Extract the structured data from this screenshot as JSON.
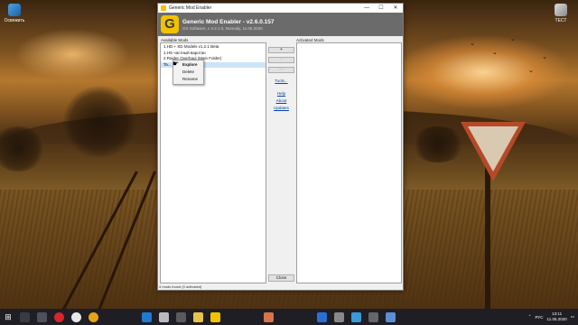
{
  "desktop": {
    "icons": [
      {
        "label": "Освежить"
      },
      {
        "label": "ТЕСТ"
      }
    ]
  },
  "window": {
    "title": "Generic Mod Enabler",
    "controls": {
      "minimize": "—",
      "maximize": "☐",
      "close": "✕"
    }
  },
  "header": {
    "logo_letter": "G",
    "app_name": "Generic Mod Enabler - v2.6.0.157",
    "subtitle": "GS Software, v 4.2.1.0, Nonnaly, 11.05.2020"
  },
  "available": {
    "label": "Available Mods",
    "items": [
      "1.HD + SD Models v1.2.1 Beta",
      "1.HS частный варотан",
      "2.Raider Overhaul (Main Folder)",
      "Ta..."
    ]
  },
  "activated": {
    "label": "Activated Mods",
    "items": []
  },
  "buttons": {
    "add": "+",
    "remove": "-",
    "remove_all": "---",
    "tools": "Tools...",
    "help": "Help",
    "about": "About",
    "updates": "Updates",
    "close": "Close"
  },
  "status": "4 mods found (0 activated)",
  "context_menu": {
    "items": [
      "Explore",
      "Delete",
      "Rename"
    ]
  },
  "taskbar": {
    "tray_lang": "РУС",
    "time": "13:11",
    "date": "11.05.2020"
  },
  "colors": {
    "header_bg": "#6b6b6b",
    "logo": "#f2c200",
    "taskbar": "#1e1e24",
    "selection": "#cce4f7"
  }
}
